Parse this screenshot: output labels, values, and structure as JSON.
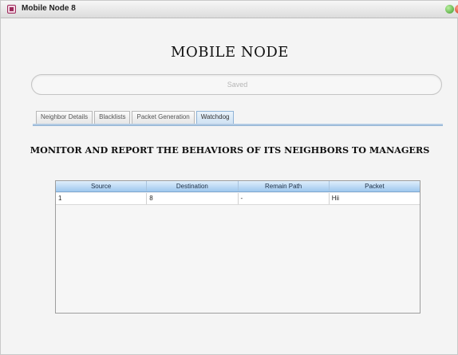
{
  "window": {
    "title": "Mobile Node 8"
  },
  "main": {
    "title": "MOBILE NODE",
    "status_field": "Saved"
  },
  "tabs": [
    {
      "label": "Neighbor Details",
      "active": false
    },
    {
      "label": "Blacklists",
      "active": false
    },
    {
      "label": "Packet Generation",
      "active": false
    },
    {
      "label": "Watchdog",
      "active": true
    }
  ],
  "watchdog": {
    "heading": "MONITOR AND REPORT THE BEHAVIORS OF ITS NEIGHBORS TO MANAGERS",
    "table": {
      "columns": [
        "Source",
        "Destination",
        "Remain Path",
        "Packet"
      ],
      "rows": [
        [
          "1",
          "8",
          "-",
          "Hii"
        ]
      ]
    }
  },
  "colors": {
    "header_gradient_top": "#dfeefc",
    "header_gradient_bottom": "#9fc7ee",
    "active_tab": "#cfe2f3"
  }
}
